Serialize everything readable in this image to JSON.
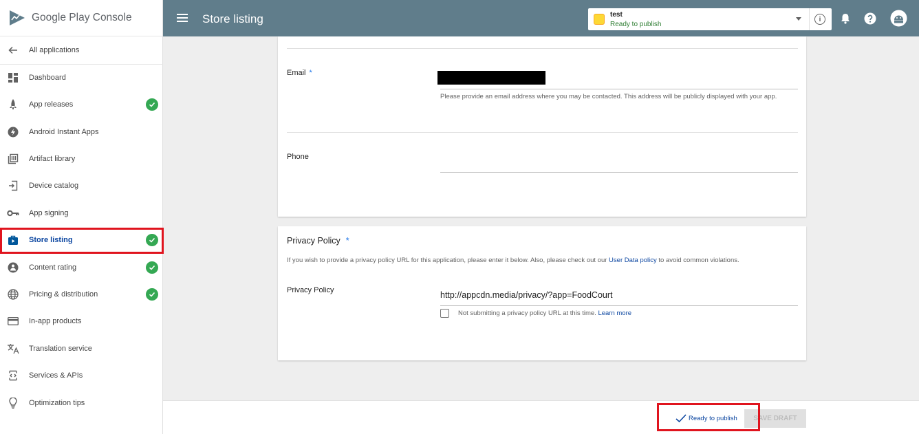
{
  "brand": {
    "name": "Google Play Console"
  },
  "sidebar": {
    "back_label": "All applications",
    "items": [
      {
        "label": "Dashboard",
        "icon": "dashboard-icon",
        "done": false
      },
      {
        "label": "App releases",
        "icon": "rocket-icon",
        "done": true
      },
      {
        "label": "Android Instant Apps",
        "icon": "bolt-icon",
        "done": false
      },
      {
        "label": "Artifact library",
        "icon": "library-icon",
        "done": false
      },
      {
        "label": "Device catalog",
        "icon": "device-icon",
        "done": false
      },
      {
        "label": "App signing",
        "icon": "key-icon",
        "done": false
      },
      {
        "label": "Store listing",
        "icon": "store-icon",
        "done": true,
        "active": true
      },
      {
        "label": "Content rating",
        "icon": "content-rating-icon",
        "done": true
      },
      {
        "label": "Pricing & distribution",
        "icon": "globe-icon",
        "done": true
      },
      {
        "label": "In-app products",
        "icon": "card-icon",
        "done": false
      },
      {
        "label": "Translation service",
        "icon": "translate-icon",
        "done": false
      },
      {
        "label": "Services & APIs",
        "icon": "api-icon",
        "done": false
      },
      {
        "label": "Optimization tips",
        "icon": "bulb-icon",
        "done": false
      }
    ]
  },
  "header": {
    "title": "Store listing",
    "app_name": "test",
    "app_status": "Ready to publish"
  },
  "contact": {
    "email_label": "Email",
    "required_mark": "*",
    "email_hint": "Please provide an email address where you may be contacted. This address will be publicly displayed with your app.",
    "phone_label": "Phone"
  },
  "privacy": {
    "title": "Privacy Policy",
    "required_mark": "*",
    "description_before": "If you wish to provide a privacy policy URL for this application, please enter it below. Also, please check out our ",
    "description_link": "User Data policy",
    "description_after": " to avoid common violations.",
    "field_label": "Privacy Policy",
    "url_value": "http://appcdn.media/privacy/?app=FoodCourt",
    "checkbox_label": "Not submitting a privacy policy URL at this time.",
    "learn_more": "Learn more"
  },
  "footer": {
    "status": "Ready to publish",
    "save_draft": "SAVE DRAFT"
  },
  "colors": {
    "topbar": "#607d8b",
    "check_green": "#34a853",
    "highlight_red": "#e0141e",
    "link_blue": "#0d47a1"
  }
}
